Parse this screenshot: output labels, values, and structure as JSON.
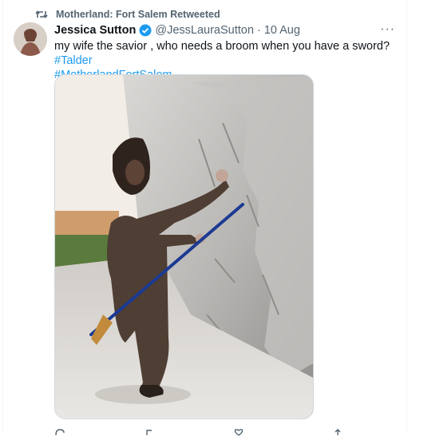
{
  "retweet": {
    "icon": "retweet-icon",
    "label": "Motherland: Fort Salem Retweeted"
  },
  "tweet": {
    "author": "Jessica Sutton",
    "verified_icon": "verified-badge-icon",
    "handle": "@JessLauraSutton",
    "separator": "·",
    "date": "10 Aug",
    "more_icon": "more-options-icon",
    "more_label": "···",
    "text": "my wife the savior , who needs a broom when you have a sword? ",
    "hashtags": [
      "#Talder",
      "#MotherlandFortSalem"
    ],
    "media_description_icon": "tweet-photo",
    "actions": [
      "reply-icon",
      "retweet-action-icon",
      "like-icon",
      "share-icon"
    ]
  },
  "colors": {
    "accent": "#1d9bf0",
    "secondary_text": "#536471",
    "primary_text": "#0f1419",
    "border": "#cfd9de"
  }
}
